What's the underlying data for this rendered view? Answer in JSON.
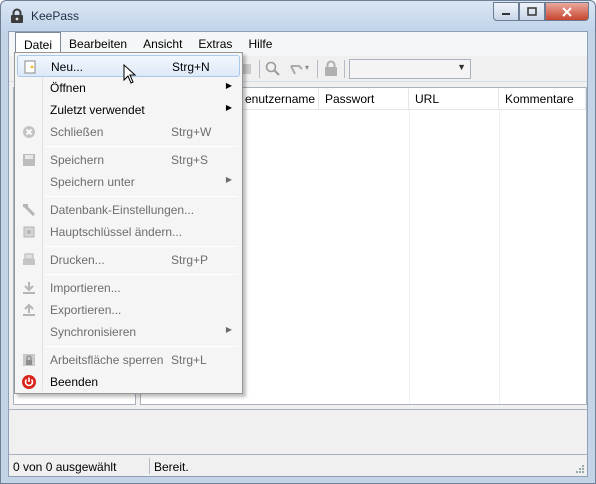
{
  "window": {
    "title": "KeePass"
  },
  "menubar": {
    "items": [
      {
        "label": "Datei"
      },
      {
        "label": "Bearbeiten"
      },
      {
        "label": "Ansicht"
      },
      {
        "label": "Extras"
      },
      {
        "label": "Hilfe"
      }
    ]
  },
  "table": {
    "columns": [
      "enutzername",
      "Passwort",
      "URL",
      "Kommentare"
    ]
  },
  "file_menu": {
    "items": [
      {
        "label": "Neu...",
        "shortcut": "Strg+N",
        "icon": "new-database-icon"
      },
      {
        "label": "Öffnen",
        "submenu": true
      },
      {
        "label": "Zuletzt verwendet",
        "submenu": true
      },
      {
        "label": "Schließen",
        "shortcut": "Strg+W",
        "icon": "close-icon"
      },
      {
        "label": "Speichern",
        "shortcut": "Strg+S",
        "icon": "save-icon"
      },
      {
        "label": "Speichern unter",
        "submenu": true
      },
      {
        "label": "Datenbank-Einstellungen...",
        "icon": "settings-tool-icon"
      },
      {
        "label": "Hauptschlüssel ändern...",
        "icon": "key-icon"
      },
      {
        "label": "Drucken...",
        "shortcut": "Strg+P",
        "icon": "print-icon"
      },
      {
        "label": "Importieren...",
        "icon": "import-icon"
      },
      {
        "label": "Exportieren...",
        "icon": "export-icon"
      },
      {
        "label": "Synchronisieren",
        "submenu": true
      },
      {
        "label": "Arbeitsfläche sperren",
        "shortcut": "Strg+L",
        "icon": "lock-icon"
      },
      {
        "label": "Beenden",
        "icon": "power-icon"
      }
    ]
  },
  "statusbar": {
    "selection": "0 von 0 ausgewählt",
    "status": "Bereit."
  },
  "colors": {
    "highlight_border": "#a8c8ec",
    "exit_icon": "#d9261c"
  }
}
